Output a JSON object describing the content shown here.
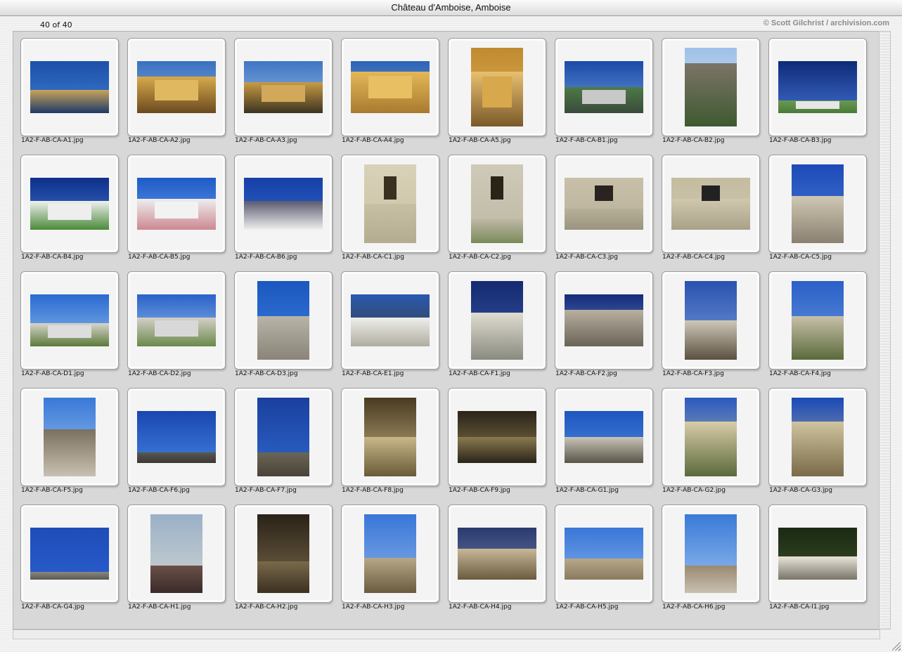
{
  "window": {
    "title": "Château d'Amboise, Amboise"
  },
  "header": {
    "count": "40 of 40",
    "copyright": "© Scott Gilchrist / archivision.com"
  },
  "slides": [
    {
      "file": "1A2-F-AB-CA-A1.jpg",
      "orient": "landscape",
      "scene": "river"
    },
    {
      "file": "1A2-F-AB-CA-A2.jpg",
      "orient": "landscape",
      "scene": "golden"
    },
    {
      "file": "1A2-F-AB-CA-A3.jpg",
      "orient": "landscape",
      "scene": "golden-river"
    },
    {
      "file": "1A2-F-AB-CA-A4.jpg",
      "orient": "landscape",
      "scene": "facade-gold"
    },
    {
      "file": "1A2-F-AB-CA-A5.jpg",
      "orient": "portrait",
      "scene": "tower-gold"
    },
    {
      "file": "1A2-F-AB-CA-B1.jpg",
      "orient": "landscape",
      "scene": "terrace"
    },
    {
      "file": "1A2-F-AB-CA-B2.jpg",
      "orient": "portrait",
      "scene": "wall-perspective"
    },
    {
      "file": "1A2-F-AB-CA-B3.jpg",
      "orient": "landscape",
      "scene": "lawn-blue"
    },
    {
      "file": "1A2-F-AB-CA-B4.jpg",
      "orient": "landscape",
      "scene": "chateau-blue"
    },
    {
      "file": "1A2-F-AB-CA-B5.jpg",
      "orient": "landscape",
      "scene": "chateau-garden"
    },
    {
      "file": "1A2-F-AB-CA-B6.jpg",
      "orient": "landscape",
      "scene": "roofline"
    },
    {
      "file": "1A2-F-AB-CA-C1.jpg",
      "orient": "portrait",
      "scene": "stone-window"
    },
    {
      "file": "1A2-F-AB-CA-C2.jpg",
      "orient": "portrait",
      "scene": "stone-window2"
    },
    {
      "file": "1A2-F-AB-CA-C3.jpg",
      "orient": "landscape",
      "scene": "stone-detail"
    },
    {
      "file": "1A2-F-AB-CA-C4.jpg",
      "orient": "landscape",
      "scene": "stone-detail2"
    },
    {
      "file": "1A2-F-AB-CA-C5.jpg",
      "orient": "portrait",
      "scene": "dormer"
    },
    {
      "file": "1A2-F-AB-CA-D1.jpg",
      "orient": "landscape",
      "scene": "towers-clouds"
    },
    {
      "file": "1A2-F-AB-CA-D2.jpg",
      "orient": "landscape",
      "scene": "towers-clouds2"
    },
    {
      "file": "1A2-F-AB-CA-D3.jpg",
      "orient": "portrait",
      "scene": "turret"
    },
    {
      "file": "1A2-F-AB-CA-E1.jpg",
      "orient": "landscape",
      "scene": "pavilion"
    },
    {
      "file": "1A2-F-AB-CA-F1.jpg",
      "orient": "portrait",
      "scene": "street"
    },
    {
      "file": "1A2-F-AB-CA-F2.jpg",
      "orient": "landscape",
      "scene": "wall-street"
    },
    {
      "file": "1A2-F-AB-CA-F3.jpg",
      "orient": "portrait",
      "scene": "chapel"
    },
    {
      "file": "1A2-F-AB-CA-F4.jpg",
      "orient": "portrait",
      "scene": "chapel2"
    },
    {
      "file": "1A2-F-AB-CA-F5.jpg",
      "orient": "portrait",
      "scene": "chapel3"
    },
    {
      "file": "1A2-F-AB-CA-F6.jpg",
      "orient": "landscape",
      "scene": "sky-clouds"
    },
    {
      "file": "1A2-F-AB-CA-F7.jpg",
      "orient": "portrait",
      "scene": "spire"
    },
    {
      "file": "1A2-F-AB-CA-F8.jpg",
      "orient": "portrait",
      "scene": "vault-gold"
    },
    {
      "file": "1A2-F-AB-CA-F9.jpg",
      "orient": "landscape",
      "scene": "vault-dark"
    },
    {
      "file": "1A2-F-AB-CA-G1.jpg",
      "orient": "landscape",
      "scene": "tower-base"
    },
    {
      "file": "1A2-F-AB-CA-G2.jpg",
      "orient": "portrait",
      "scene": "ornate-tower"
    },
    {
      "file": "1A2-F-AB-CA-G3.jpg",
      "orient": "portrait",
      "scene": "ornate-tower2"
    },
    {
      "file": "1A2-F-AB-CA-G4.jpg",
      "orient": "landscape",
      "scene": "cloud-dome"
    },
    {
      "file": "1A2-F-AB-CA-H1.jpg",
      "orient": "portrait",
      "scene": "corridor"
    },
    {
      "file": "1A2-F-AB-CA-H2.jpg",
      "orient": "portrait",
      "scene": "vault-dark2"
    },
    {
      "file": "1A2-F-AB-CA-H3.jpg",
      "orient": "portrait",
      "scene": "gargoyle"
    },
    {
      "file": "1A2-F-AB-CA-H4.jpg",
      "orient": "landscape",
      "scene": "gargoyle-window"
    },
    {
      "file": "1A2-F-AB-CA-H5.jpg",
      "orient": "landscape",
      "scene": "gargoyle-sky"
    },
    {
      "file": "1A2-F-AB-CA-H6.jpg",
      "orient": "portrait",
      "scene": "gargoyle2"
    },
    {
      "file": "1A2-F-AB-CA-I1.jpg",
      "orient": "landscape",
      "scene": "bust"
    }
  ]
}
